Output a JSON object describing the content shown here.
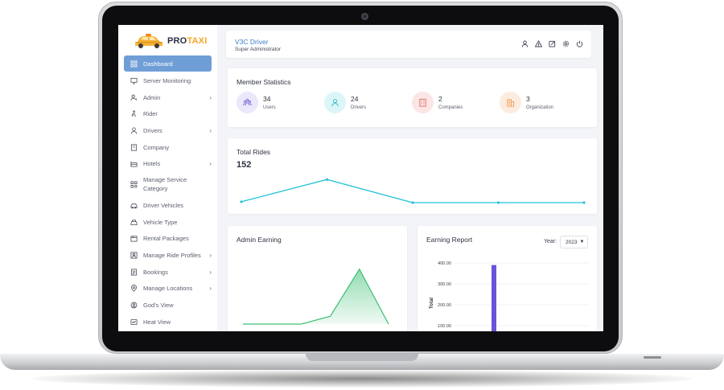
{
  "app": {
    "logo_pro": "PRO",
    "logo_taxi": "TAXI"
  },
  "sidebar": {
    "items": [
      {
        "label": "Dashboard",
        "icon": "grid-icon",
        "active": true,
        "has_submenu": false
      },
      {
        "label": "Server Monitoring",
        "icon": "monitor-icon",
        "active": false,
        "has_submenu": false
      },
      {
        "label": "Admin",
        "icon": "admin-icon",
        "active": false,
        "has_submenu": true
      },
      {
        "label": "Rider",
        "icon": "rider-icon",
        "active": false,
        "has_submenu": false
      },
      {
        "label": "Drivers",
        "icon": "driver-icon",
        "active": false,
        "has_submenu": true
      },
      {
        "label": "Company",
        "icon": "building-icon",
        "active": false,
        "has_submenu": false
      },
      {
        "label": "Hotels",
        "icon": "hotel-icon",
        "active": false,
        "has_submenu": true
      },
      {
        "label": "Manage Service Category",
        "icon": "category-icon",
        "active": false,
        "has_submenu": false
      },
      {
        "label": "Driver Vehicles",
        "icon": "vehicle-icon",
        "active": false,
        "has_submenu": false
      },
      {
        "label": "Vehicle Type",
        "icon": "car-icon",
        "active": false,
        "has_submenu": false
      },
      {
        "label": "Rental Packages",
        "icon": "package-icon",
        "active": false,
        "has_submenu": false
      },
      {
        "label": "Manage Ride Profiles",
        "icon": "profile-icon",
        "active": false,
        "has_submenu": true
      },
      {
        "label": "Bookings",
        "icon": "booking-icon",
        "active": false,
        "has_submenu": true
      },
      {
        "label": "Manage Locations",
        "icon": "location-icon",
        "active": false,
        "has_submenu": true
      },
      {
        "label": "God's View",
        "icon": "eye-icon",
        "active": false,
        "has_submenu": false
      },
      {
        "label": "Heat View",
        "icon": "heat-icon",
        "active": false,
        "has_submenu": false
      }
    ]
  },
  "header": {
    "user_name": "V3C Driver",
    "user_role": "Super Administrator",
    "icons": [
      "user-icon",
      "warning-icon",
      "edit-icon",
      "settings-icon",
      "power-icon"
    ]
  },
  "member_statistics": {
    "title": "Member Statistics",
    "stats": [
      {
        "value": "34",
        "label": "Users",
        "icon": "users-icon",
        "bg": "#ece8fb",
        "fg": "#7b6ad8"
      },
      {
        "value": "24",
        "label": "Drivers",
        "icon": "driver-icon",
        "bg": "#dcf6f8",
        "fg": "#2bbad0"
      },
      {
        "value": "2",
        "label": "Companies",
        "icon": "building-icon",
        "bg": "#fbe5e5",
        "fg": "#e06a6a"
      },
      {
        "value": "3",
        "label": "Organization",
        "icon": "organization-icon",
        "bg": "#fcecdf",
        "fg": "#ee9a4f"
      }
    ]
  },
  "total_rides": {
    "title": "Total Rides",
    "value": "152",
    "color": "#25c3d7"
  },
  "admin_earning": {
    "title": "Admin Earning",
    "color": "#3bbf73"
  },
  "earning_report": {
    "title": "Earning Report",
    "year_label": "Year:",
    "year_value": "2023",
    "bar_color": "#6a52d9"
  },
  "chart_data": [
    {
      "type": "line",
      "title": "Total Rides",
      "x": [
        1,
        2,
        3,
        4,
        5
      ],
      "series": [
        {
          "values": [
            1,
            27,
            0,
            0,
            0
          ]
        }
      ],
      "ylim": [
        0,
        30
      ],
      "grid": false
    },
    {
      "type": "area",
      "title": "Admin Earning",
      "x": [
        1,
        2,
        3,
        4,
        5,
        6
      ],
      "series": [
        {
          "values": [
            0,
            0,
            0,
            10,
            70,
            0
          ]
        }
      ],
      "ylim": [
        0,
        80
      ],
      "grid": false
    },
    {
      "type": "bar",
      "title": "Earning Report",
      "ylabel": "Total",
      "y_ticks": [
        "400.00",
        "300.00",
        "200.00",
        "100.00"
      ],
      "categories": [
        "",
        "",
        "",
        "",
        "",
        "",
        "",
        "",
        "",
        "",
        "",
        ""
      ],
      "values": [
        0,
        0,
        0,
        390,
        0,
        0,
        0,
        0,
        0,
        0,
        0,
        0
      ],
      "ylim": [
        0,
        450
      ],
      "grid": true
    }
  ]
}
